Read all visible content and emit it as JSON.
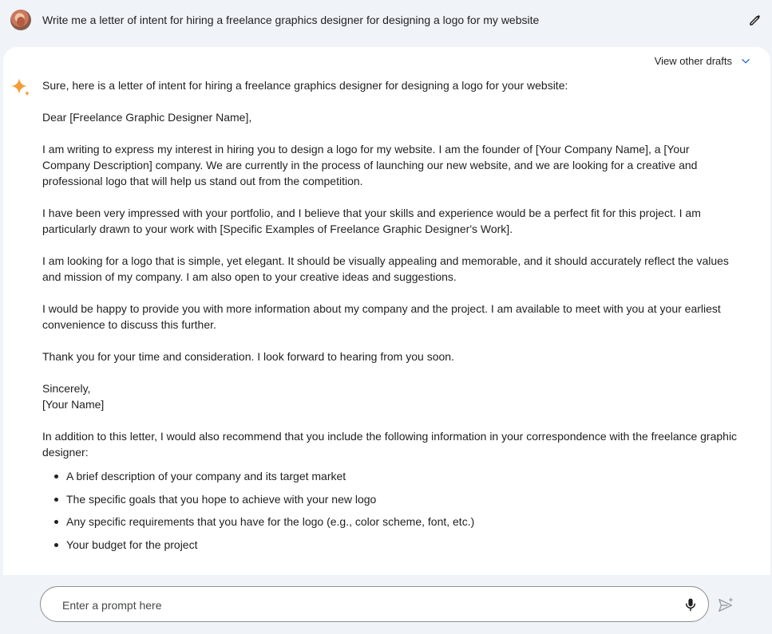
{
  "prompt": {
    "text": "Write me a letter of intent for hiring a freelance graphics designer for designing a logo for my website"
  },
  "response": {
    "view_drafts_label": "View other drafts",
    "intro": "Sure, here is a letter of intent for hiring a freelance graphics designer for designing a logo for your website:",
    "greeting": "Dear [Freelance Graphic Designer Name],",
    "paragraphs": [
      "I am writing to express my interest in hiring you to design a logo for my website. I am the founder of [Your Company Name], a [Your Company Description] company. We are currently in the process of launching our new website, and we are looking for a creative and professional logo that will help us stand out from the competition.",
      "I have been very impressed with your portfolio, and I believe that your skills and experience would be a perfect fit for this project. I am particularly drawn to your work with [Specific Examples of Freelance Graphic Designer's Work].",
      "I am looking for a logo that is simple, yet elegant. It should be visually appealing and memorable, and it should accurately reflect the values and mission of my company. I am also open to your creative ideas and suggestions.",
      "I would be happy to provide you with more information about my company and the project. I am available to meet with you at your earliest convenience to discuss this further.",
      "Thank you for your time and consideration. I look forward to hearing from you soon."
    ],
    "closing": "Sincerely,",
    "signature": "[Your Name]",
    "recommendation": "In addition to this letter, I would also recommend that you include the following information in your correspondence with the freelance graphic designer:",
    "bullets": [
      "A brief description of your company and its target market",
      "The specific goals that you hope to achieve with your new logo",
      "Any specific requirements that you have for the logo (e.g., color scheme, font, etc.)",
      "Your budget for the project"
    ]
  },
  "input": {
    "placeholder": "Enter a prompt here"
  },
  "icons": {
    "edit": "pencil-icon",
    "drafts": "chevron-down-icon",
    "assistant": "sparkle-icon",
    "mic": "microphone-icon",
    "send": "send-icon"
  },
  "colors": {
    "page_background": "#f0f4f9",
    "card_background": "#ffffff",
    "accent_link": "#0b57d0",
    "sparkle_orange": "#f29c38"
  }
}
